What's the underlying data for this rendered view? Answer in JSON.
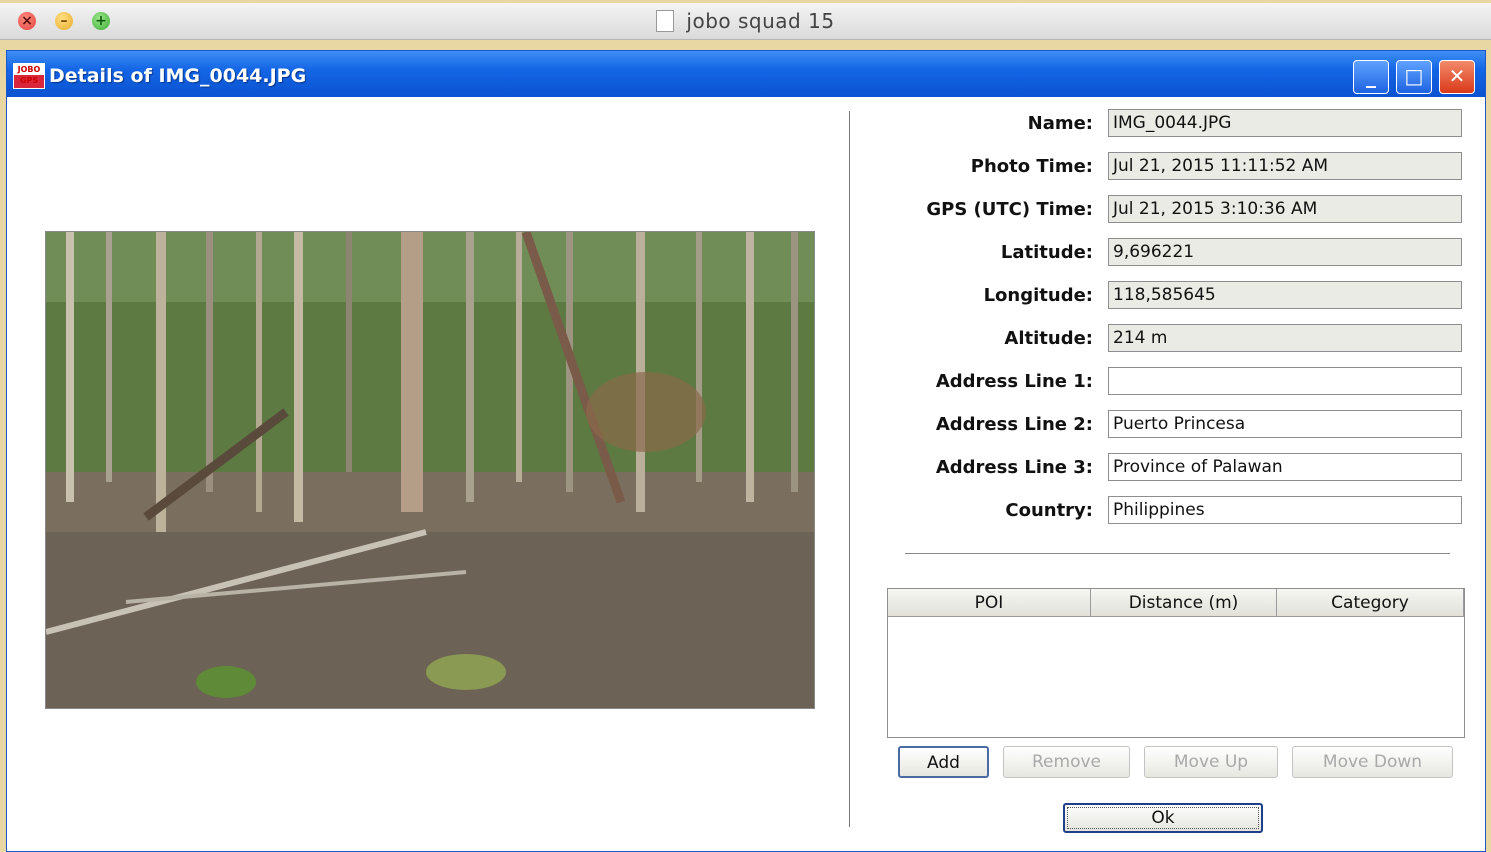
{
  "mac_window": {
    "title": "jobo squad 15"
  },
  "dialog": {
    "title": "Details of IMG_0044.JPG",
    "app_icon_text": "JOBO GPS"
  },
  "details": {
    "fields": [
      {
        "label": "Name:",
        "value": "IMG_0044.JPG"
      },
      {
        "label": "Photo Time:",
        "value": "Jul 21, 2015 11:11:52 AM"
      },
      {
        "label": "GPS (UTC) Time:",
        "value": "Jul 21, 2015 3:10:36 AM"
      },
      {
        "label": "Latitude:",
        "value": "9,696221"
      },
      {
        "label": "Longitude:",
        "value": "118,585645"
      },
      {
        "label": "Altitude:",
        "value": "214 m"
      },
      {
        "label": "Address Line 1:",
        "value": ""
      },
      {
        "label": "Address Line 2:",
        "value": "Puerto Princesa"
      },
      {
        "label": "Address Line 3:",
        "value": "Province of Palawan"
      },
      {
        "label": "Country:",
        "value": "Philippines"
      }
    ]
  },
  "poi_table": {
    "columns": [
      "POI",
      "Distance (m)",
      "Category"
    ],
    "rows": []
  },
  "buttons": {
    "add": "Add",
    "remove": "Remove",
    "move_up": "Move Up",
    "move_down": "Move Down",
    "ok": "Ok"
  }
}
